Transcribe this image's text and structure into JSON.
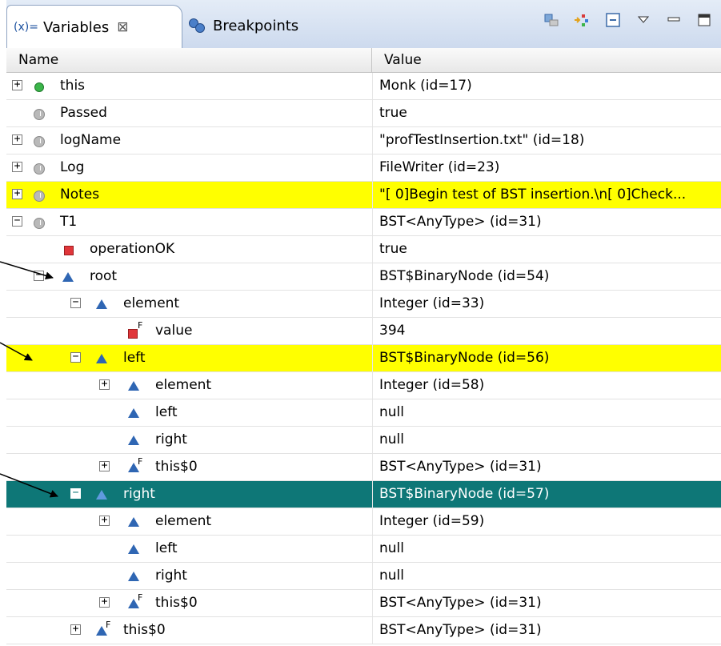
{
  "tabs": [
    {
      "icon": "(x)=",
      "label": "Variables",
      "active": true
    },
    {
      "label": "Breakpoints",
      "active": false
    }
  ],
  "toolbar": [
    "show-type-names-icon",
    "collapse-all-icon",
    "select-all-icon",
    "view-menu-icon",
    "minimize-icon",
    "maximize-icon"
  ],
  "columns": {
    "name": "Name",
    "value": "Value"
  },
  "colors": {
    "highlight": "#ffff00",
    "selected": "#0e7777",
    "tab_bg": "#d6e2f2"
  },
  "rows": [
    {
      "name": "this",
      "value": "Monk  (id=17)",
      "depth": 0,
      "expander": "plus",
      "icon": "local-variable-icon",
      "style": ""
    },
    {
      "name": "Passed",
      "value": "true",
      "depth": 0,
      "expander": "",
      "icon": "protected-field-icon",
      "style": ""
    },
    {
      "name": "logName",
      "value": "\"profTestInsertion.txt\" (id=18)",
      "depth": 0,
      "expander": "plus",
      "icon": "protected-field-icon",
      "style": ""
    },
    {
      "name": "Log",
      "value": "FileWriter  (id=23)",
      "depth": 0,
      "expander": "plus",
      "icon": "protected-field-icon",
      "style": ""
    },
    {
      "name": "Notes",
      "value": "\"[ 0]Begin test of BST insertion.\\n[ 0]Check...",
      "depth": 0,
      "expander": "plus",
      "icon": "protected-field-icon",
      "style": "hl"
    },
    {
      "name": "T1",
      "value": "BST<AnyType>  (id=31)",
      "depth": 0,
      "expander": "minus",
      "icon": "protected-field-icon",
      "style": ""
    },
    {
      "name": "operationOK",
      "value": "true",
      "depth": 1,
      "expander": "",
      "icon": "private-field-icon",
      "style": ""
    },
    {
      "name": "root",
      "value": "BST$BinaryNode  (id=54)",
      "depth": 1,
      "expander": "minus",
      "icon": "package-field-icon",
      "style": ""
    },
    {
      "name": "element",
      "value": "Integer  (id=33)",
      "depth": 2,
      "expander": "minus",
      "icon": "package-field-icon",
      "style": ""
    },
    {
      "name": "value",
      "value": "394",
      "depth": 3,
      "expander": "",
      "icon": "private-final-field-icon",
      "style": ""
    },
    {
      "name": "left",
      "value": "BST$BinaryNode  (id=56)",
      "depth": 2,
      "expander": "minus",
      "icon": "package-field-icon",
      "style": "hl"
    },
    {
      "name": "element",
      "value": "Integer  (id=58)",
      "depth": 3,
      "expander": "plus",
      "icon": "package-field-icon",
      "style": ""
    },
    {
      "name": "left",
      "value": "null",
      "depth": 3,
      "expander": "",
      "icon": "package-field-icon",
      "style": ""
    },
    {
      "name": "right",
      "value": "null",
      "depth": 3,
      "expander": "",
      "icon": "package-field-icon",
      "style": ""
    },
    {
      "name": "this$0",
      "value": "BST<AnyType>  (id=31)",
      "depth": 3,
      "expander": "plus",
      "icon": "package-final-field-icon",
      "style": ""
    },
    {
      "name": "right",
      "value": "BST$BinaryNode  (id=57)",
      "depth": 2,
      "expander": "minus",
      "icon": "package-field-icon",
      "style": "sel"
    },
    {
      "name": "element",
      "value": "Integer  (id=59)",
      "depth": 3,
      "expander": "plus",
      "icon": "package-field-icon",
      "style": ""
    },
    {
      "name": "left",
      "value": "null",
      "depth": 3,
      "expander": "",
      "icon": "package-field-icon",
      "style": ""
    },
    {
      "name": "right",
      "value": "null",
      "depth": 3,
      "expander": "",
      "icon": "package-field-icon",
      "style": ""
    },
    {
      "name": "this$0",
      "value": "BST<AnyType>  (id=31)",
      "depth": 3,
      "expander": "plus",
      "icon": "package-final-field-icon",
      "style": ""
    },
    {
      "name": "this$0",
      "value": "BST<AnyType>  (id=31)",
      "depth": 2,
      "expander": "plus",
      "icon": "package-final-field-icon",
      "style": ""
    }
  ]
}
